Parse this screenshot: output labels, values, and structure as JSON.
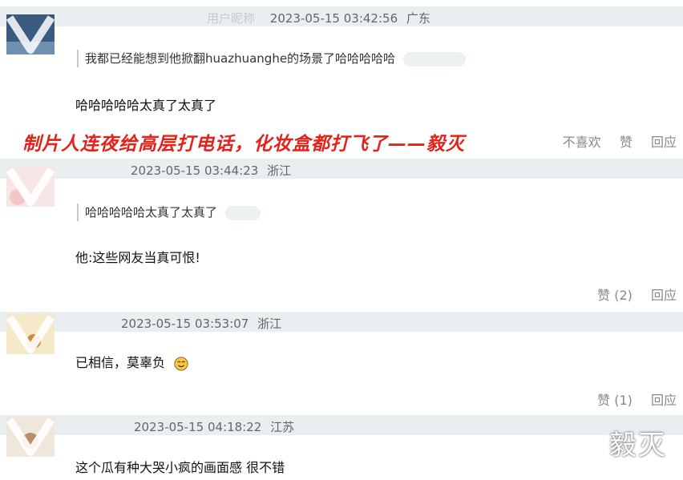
{
  "comments": [
    {
      "username": "用户昵称",
      "time": "2023-05-15 03:42:56",
      "location": "广东",
      "quote": "我都已经能想到他掀翻huazhuanghe的场景了哈哈哈哈哈",
      "text": "哈哈哈哈哈太真了太真了",
      "actions": {
        "like": "赞",
        "reply": "回应"
      }
    },
    {
      "time": "2023-05-15 03:44:23",
      "location": "浙江",
      "quote": "哈哈哈哈哈太真了太真了",
      "text": "他:这些网友当真可恨!",
      "actions": {
        "like": "赞 (2)",
        "reply": "回应"
      }
    },
    {
      "time": "2023-05-15 03:53:07",
      "location": "浙江",
      "text": "已相信，莫辜负",
      "actions": {
        "like": "赞 (1)",
        "reply": "回应"
      }
    },
    {
      "time": "2023-05-15 04:18:22",
      "location": "江苏",
      "text": "这个瓜有种大哭小疯的画面感 很不错"
    }
  ],
  "first_actions": {
    "dislike": "不喜欢",
    "like": "赞",
    "reply": "回应"
  },
  "overlay_caption": "制片人连夜给高层打电话，化妆盒都打飞了——毅灭",
  "watermark": "毅灭",
  "colors": {
    "band": "#e9eef0",
    "overlay": "#e3221b",
    "meta": "#666666"
  },
  "icons": {
    "emoji": "smile-emoji-icon",
    "avatar_mark": "v-mark-icon"
  }
}
